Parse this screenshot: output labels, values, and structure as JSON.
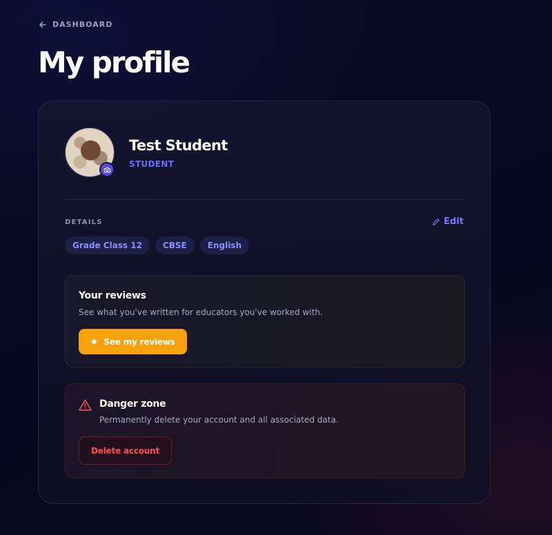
{
  "nav": {
    "back_label": "DASHBOARD"
  },
  "page": {
    "title": "My profile"
  },
  "profile": {
    "name": "Test Student",
    "role": "STUDENT"
  },
  "details": {
    "label": "DETAILS",
    "edit_label": "Edit",
    "chips": [
      "Grade Class 12",
      "CBSE",
      "English"
    ]
  },
  "reviews": {
    "title": "Your reviews",
    "description": "See what you've written for educators you've worked with.",
    "button_label": "See my reviews"
  },
  "danger": {
    "title": "Danger zone",
    "description": "Permanently delete your account and all associated data.",
    "button_label": "Delete account"
  },
  "colors": {
    "accent": "#6f6bff",
    "cta": "#f7a10d",
    "danger": "#ff4d57"
  },
  "icons": [
    "arrow-left-icon",
    "camera-icon",
    "pencil-icon",
    "star-icon",
    "warning-icon"
  ]
}
